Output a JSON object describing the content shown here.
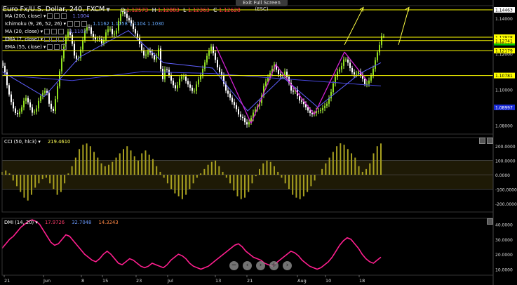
{
  "header": {
    "exit_button": "Exit Full Screen (ESC)",
    "instrument": "Euro Fx/U.S. Dollar, 240, FXCM",
    "ohlc": [
      {
        "label": "O",
        "value": "1.12573"
      },
      {
        "label": "H",
        "value": "1.12883"
      },
      {
        "label": "L",
        "value": "1.12363"
      },
      {
        "label": "C",
        "value": "1.12628"
      }
    ]
  },
  "indicators": [
    {
      "label": "MA (200, close)",
      "value": "1.1004",
      "color": "#6b6bff"
    },
    {
      "label": "Ichimoku (9, 26, 52, 26)",
      "value": "1.1162  1.1158  1.1104  1.1030",
      "color": "#66aaff"
    },
    {
      "label": "MA (20, close)",
      "value": "1.1103",
      "color": "#6b6bff"
    },
    {
      "label": "EMA (7, close)",
      "value": "",
      "color": "#bbbbbb"
    },
    {
      "label": "EMA (55, close)",
      "value": "",
      "color": "#bbbbbb"
    }
  ],
  "cci_panel": {
    "label": "CCI (50, hlc3)",
    "value": "219.4610"
  },
  "dmi_panel": {
    "label": "DMI (14, 20)",
    "values": [
      "17.9726",
      "32.7048",
      "14.3243"
    ]
  },
  "price_axis_labels": [
    "1.14000",
    "1.12000",
    "1.10000",
    "1.08000"
  ],
  "price_tags": [
    {
      "value": "1.14463",
      "bg": "#ffffff",
      "fg": "#000000"
    },
    {
      "value": "1.12928",
      "bg": "#ffff00",
      "fg": "#000000"
    },
    {
      "value": "1.12628",
      "bg": "#00cc00",
      "fg": "#000000"
    },
    {
      "value": "1.12741",
      "bg": "#ffff00",
      "fg": "#000000"
    },
    {
      "value": "1.12179",
      "bg": "#ffff00",
      "fg": "#000000"
    },
    {
      "value": "1.10781",
      "bg": "#ffff00",
      "fg": "#000000"
    },
    {
      "value": "1.08997",
      "bg": "#1a2bd6",
      "fg": "#ffffff"
    }
  ],
  "cci_axis_labels": [
    "200.0000",
    "100.0000",
    "0.0000",
    "-100.0000",
    "-200.0000"
  ],
  "dmi_axis_labels": [
    "40.0000",
    "30.0000",
    "20.0000",
    "10.0000"
  ],
  "x_axis_labels": [
    "21",
    "Jun",
    "8",
    "15",
    "23",
    "Jul",
    "13",
    "21",
    "Aug",
    "10",
    "18"
  ],
  "nav_buttons": [
    "−",
    "‹",
    "›",
    "+",
    "›"
  ],
  "chart_data": {
    "type": "line",
    "title": "Euro Fx/U.S. Dollar, 240, FXCM",
    "ylim": [
      1.075,
      1.147
    ],
    "horizontal_levels": [
      1.14463,
      1.12928,
      1.12741,
      1.12179,
      1.10781
    ],
    "price_path": [
      [
        0,
        1.115
      ],
      [
        5,
        1.112
      ],
      [
        10,
        1.1
      ],
      [
        15,
        1.093
      ],
      [
        20,
        1.087
      ],
      [
        25,
        1.086
      ],
      [
        30,
        1.09
      ],
      [
        35,
        1.096
      ],
      [
        40,
        1.092
      ],
      [
        45,
        1.087
      ],
      [
        50,
        1.088
      ],
      [
        55,
        1.095
      ],
      [
        60,
        1.098
      ],
      [
        65,
        1.1
      ],
      [
        70,
        1.09
      ],
      [
        75,
        1.088
      ],
      [
        80,
        1.099
      ],
      [
        85,
        1.113
      ],
      [
        90,
        1.124
      ],
      [
        95,
        1.133
      ],
      [
        100,
        1.13
      ],
      [
        105,
        1.119
      ],
      [
        110,
        1.116
      ],
      [
        115,
        1.124
      ],
      [
        120,
        1.133
      ],
      [
        125,
        1.136
      ],
      [
        130,
        1.13
      ],
      [
        135,
        1.128
      ],
      [
        140,
        1.129
      ],
      [
        145,
        1.125
      ],
      [
        150,
        1.132
      ],
      [
        155,
        1.135
      ],
      [
        160,
        1.13
      ],
      [
        165,
        1.133
      ],
      [
        170,
        1.142
      ],
      [
        175,
        1.144
      ],
      [
        180,
        1.14
      ],
      [
        185,
        1.138
      ],
      [
        190,
        1.133
      ],
      [
        195,
        1.129
      ],
      [
        200,
        1.123
      ],
      [
        205,
        1.118
      ],
      [
        210,
        1.122
      ],
      [
        215,
        1.12
      ],
      [
        220,
        1.116
      ],
      [
        225,
        1.123
      ],
      [
        230,
        1.104
      ],
      [
        235,
        1.113
      ],
      [
        240,
        1.108
      ],
      [
        245,
        1.103
      ],
      [
        250,
        1.1
      ],
      [
        255,
        1.106
      ],
      [
        260,
        1.108
      ],
      [
        265,
        1.104
      ],
      [
        270,
        1.101
      ],
      [
        275,
        1.098
      ],
      [
        280,
        1.104
      ],
      [
        285,
        1.108
      ],
      [
        290,
        1.114
      ],
      [
        295,
        1.12
      ],
      [
        300,
        1.124
      ],
      [
        305,
        1.118
      ],
      [
        310,
        1.111
      ],
      [
        315,
        1.108
      ],
      [
        320,
        1.1
      ],
      [
        325,
        1.097
      ],
      [
        330,
        1.093
      ],
      [
        335,
        1.09
      ],
      [
        340,
        1.085
      ],
      [
        345,
        1.084
      ],
      [
        350,
        1.08
      ],
      [
        355,
        1.082
      ],
      [
        360,
        1.087
      ],
      [
        365,
        1.09
      ],
      [
        370,
        1.093
      ],
      [
        375,
        1.102
      ],
      [
        380,
        1.106
      ],
      [
        385,
        1.11
      ],
      [
        390,
        1.114
      ],
      [
        395,
        1.109
      ],
      [
        400,
        1.107
      ],
      [
        405,
        1.11
      ],
      [
        410,
        1.105
      ],
      [
        415,
        1.098
      ],
      [
        420,
        1.1
      ],
      [
        425,
        1.094
      ],
      [
        430,
        1.093
      ],
      [
        435,
        1.09
      ],
      [
        440,
        1.087
      ],
      [
        445,
        1.086
      ],
      [
        450,
        1.088
      ],
      [
        455,
        1.088
      ],
      [
        460,
        1.09
      ],
      [
        465,
        1.092
      ],
      [
        470,
        1.097
      ],
      [
        475,
        1.105
      ],
      [
        480,
        1.11
      ],
      [
        485,
        1.112
      ],
      [
        490,
        1.118
      ],
      [
        495,
        1.115
      ],
      [
        500,
        1.11
      ],
      [
        505,
        1.108
      ],
      [
        510,
        1.11
      ],
      [
        515,
        1.107
      ],
      [
        520,
        1.102
      ],
      [
        525,
        1.105
      ],
      [
        530,
        1.11
      ],
      [
        535,
        1.118
      ],
      [
        540,
        1.125
      ],
      [
        543,
        1.13
      ]
    ],
    "ma200": [
      [
        0,
        1.108
      ],
      [
        100,
        1.105
      ],
      [
        200,
        1.11
      ],
      [
        300,
        1.109
      ],
      [
        400,
        1.106
      ],
      [
        470,
        1.104
      ],
      [
        540,
        1.102
      ]
    ],
    "ma20": [
      [
        0,
        1.11
      ],
      [
        60,
        1.096
      ],
      [
        110,
        1.118
      ],
      [
        180,
        1.133
      ],
      [
        230,
        1.115
      ],
      [
        300,
        1.112
      ],
      [
        350,
        1.088
      ],
      [
        400,
        1.107
      ],
      [
        450,
        1.09
      ],
      [
        510,
        1.109
      ],
      [
        540,
        1.115
      ]
    ],
    "trendlines_magenta": [
      [
        [
          305,
          1.124
        ],
        [
          355,
          1.081
        ]
      ],
      [
        [
          355,
          1.081
        ],
        [
          390,
          1.114
        ]
      ],
      [
        [
          390,
          1.114
        ],
        [
          445,
          1.086
        ]
      ],
      [
        [
          445,
          1.086
        ],
        [
          488,
          1.121
        ]
      ],
      [
        [
          488,
          1.121
        ],
        [
          520,
          1.105
        ]
      ]
    ],
    "projection_arrows_yellow": [
      [
        [
          488,
          1.125
        ],
        [
          515,
          1.146
        ]
      ],
      [
        [
          565,
          1.125
        ],
        [
          580,
          1.146
        ]
      ]
    ],
    "cci": {
      "ylim": [
        -260,
        260
      ],
      "values": [
        20,
        30,
        10,
        -40,
        -80,
        -120,
        -160,
        -180,
        -140,
        -90,
        -60,
        -30,
        -20,
        -60,
        -100,
        -140,
        -120,
        -60,
        10,
        60,
        120,
        180,
        210,
        219,
        200,
        160,
        120,
        80,
        60,
        70,
        90,
        120,
        150,
        180,
        200,
        170,
        130,
        100,
        150,
        170,
        140,
        110,
        60,
        20,
        -20,
        -60,
        -100,
        -130,
        -150,
        -170,
        -140,
        -100,
        -60,
        -20,
        10,
        40,
        70,
        90,
        100,
        60,
        20,
        -20,
        -60,
        -110,
        -150,
        -170,
        -160,
        -120,
        -60,
        -10,
        40,
        80,
        100,
        90,
        60,
        20,
        -20,
        -60,
        -100,
        -140,
        -160,
        -170,
        -150,
        -120,
        -80,
        -40,
        0,
        40,
        80,
        120,
        160,
        200,
        220,
        210,
        180,
        150,
        120,
        60,
        20,
        40,
        80,
        150,
        200,
        219
      ]
    },
    "dmi": {
      "ylim": [
        6,
        44
      ],
      "adx": [
        24,
        27,
        30,
        32,
        35,
        38,
        40,
        42,
        43,
        42,
        40,
        36,
        32,
        28,
        26,
        27,
        30,
        33,
        32,
        29,
        26,
        23,
        20,
        18,
        16,
        15,
        17,
        20,
        22,
        20,
        17,
        14,
        13,
        15,
        17,
        16,
        14,
        12,
        11,
        12,
        14,
        13,
        12,
        11,
        13,
        16,
        18,
        20,
        19,
        17,
        14,
        12,
        11,
        10,
        11,
        12,
        14,
        16,
        18,
        20,
        22,
        24,
        26,
        27,
        25,
        22,
        20,
        18,
        17,
        16,
        14,
        13,
        12,
        14,
        16,
        18,
        20,
        22,
        21,
        19,
        16,
        14,
        12,
        11,
        10,
        11,
        13,
        15,
        18,
        22,
        26,
        29,
        31,
        30,
        27,
        24,
        20,
        17,
        15,
        14,
        16,
        18
      ]
    }
  }
}
